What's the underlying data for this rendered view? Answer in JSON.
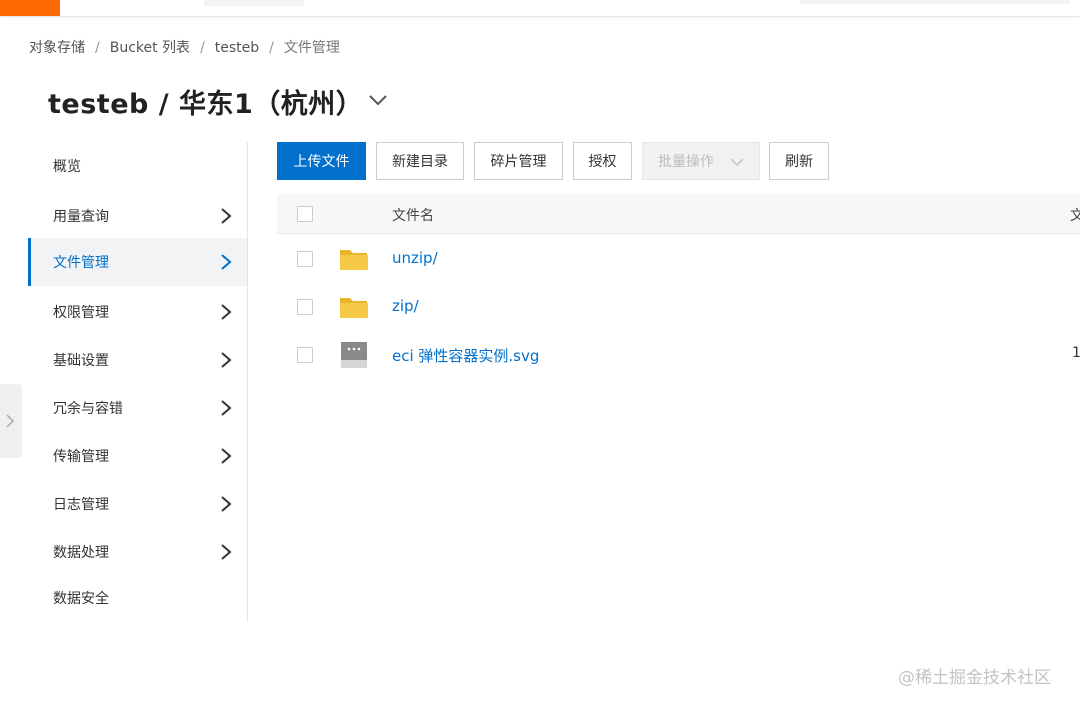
{
  "breadcrumb": {
    "items": [
      "对象存储",
      "Bucket 列表",
      "testeb",
      "文件管理"
    ],
    "separator": "/"
  },
  "page": {
    "title": "testeb / 华东1（杭州）"
  },
  "sidebar": {
    "items": [
      {
        "label": "概览",
        "has_chevron": false,
        "active": false
      },
      {
        "label": "用量查询",
        "has_chevron": true,
        "active": false
      },
      {
        "label": "文件管理",
        "has_chevron": true,
        "active": true
      },
      {
        "label": "权限管理",
        "has_chevron": true,
        "active": false
      },
      {
        "label": "基础设置",
        "has_chevron": true,
        "active": false
      },
      {
        "label": "冗余与容错",
        "has_chevron": true,
        "active": false
      },
      {
        "label": "传输管理",
        "has_chevron": true,
        "active": false
      },
      {
        "label": "日志管理",
        "has_chevron": true,
        "active": false
      },
      {
        "label": "数据处理",
        "has_chevron": true,
        "active": false
      },
      {
        "label": "数据安全",
        "has_chevron": false,
        "active": false
      }
    ]
  },
  "toolbar": {
    "upload_label": "上传文件",
    "new_dir_label": "新建目录",
    "fragment_label": "碎片管理",
    "authorize_label": "授权",
    "batch_label": "批量操作",
    "refresh_label": "刷新"
  },
  "table": {
    "header_name": "文件名",
    "header_next": "文",
    "rows": [
      {
        "name": "unzip/",
        "type": "folder",
        "size": ""
      },
      {
        "name": "zip/",
        "type": "folder",
        "size": ""
      },
      {
        "name": "eci 弹性容器实例.svg",
        "type": "file",
        "size": "1"
      }
    ]
  },
  "watermark": "@稀土掘金技术社区",
  "colors": {
    "brand": "#ff6a00",
    "primary": "#0070cc",
    "folder": "#f7c948",
    "file_icon": "#8a8a8a"
  },
  "icons": {
    "folder": "folder-icon",
    "file": "file-icon",
    "chevron_right": "chevron-right-icon",
    "chevron_down": "chevron-down-icon"
  }
}
